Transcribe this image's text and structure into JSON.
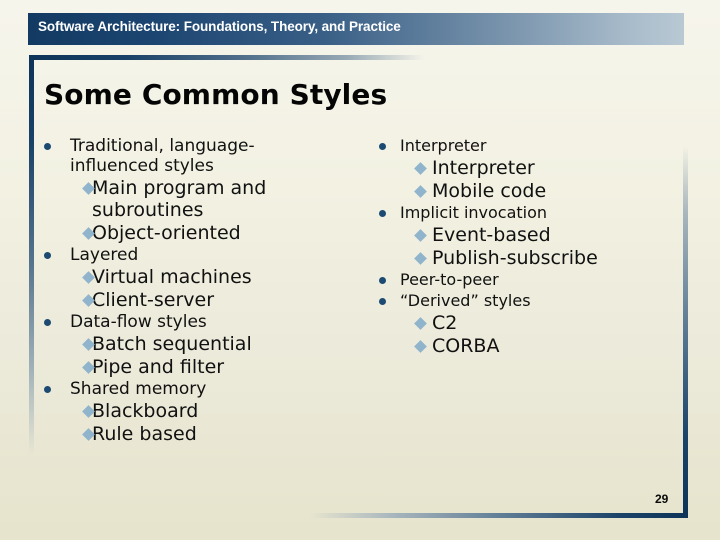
{
  "header": {
    "title": "Software Architecture: Foundations, Theory, and Practice"
  },
  "slide": {
    "title": "Some Common Styles",
    "page_number": "29"
  },
  "colors": {
    "banner_dark": "#123a62",
    "banner_light": "#b9c9d4",
    "bullet_level1": "#1c4a72",
    "bullet_level2": "#8fb4cc",
    "background_top": "#f6f5ec",
    "background_bottom": "#e6e4cc",
    "text": "#111111"
  },
  "content": {
    "left_column": [
      {
        "level": 1,
        "text": "Traditional, language-influenced styles",
        "wrap": true
      },
      {
        "level": 2,
        "text": "Main program and subroutines"
      },
      {
        "level": 2,
        "text": "Object-oriented"
      },
      {
        "level": 1,
        "text": "Layered"
      },
      {
        "level": 2,
        "text": "Virtual machines"
      },
      {
        "level": 2,
        "text": "Client-server"
      },
      {
        "level": 1,
        "text": "Data-flow styles"
      },
      {
        "level": 2,
        "text": "Batch sequential"
      },
      {
        "level": 2,
        "text": "Pipe and filter"
      },
      {
        "level": 1,
        "text": "Shared memory"
      },
      {
        "level": 2,
        "text": "Blackboard"
      },
      {
        "level": 2,
        "text": "Rule based"
      }
    ],
    "right_column": [
      {
        "level": 1,
        "text": "Interpreter"
      },
      {
        "level": 2,
        "text": "Interpreter"
      },
      {
        "level": 2,
        "text": "Mobile code"
      },
      {
        "level": 1,
        "text": "Implicit invocation"
      },
      {
        "level": 2,
        "text": "Event-based"
      },
      {
        "level": 2,
        "text": "Publish-subscribe"
      },
      {
        "level": 1,
        "text": "Peer-to-peer"
      },
      {
        "level": 1,
        "text": "“Derived” styles"
      },
      {
        "level": 2,
        "text": "C2"
      },
      {
        "level": 2,
        "text": "CORBA"
      }
    ]
  },
  "icons": {
    "bullet_level1": "filled-circle-bullet",
    "bullet_level2": "diamond-bullet"
  }
}
